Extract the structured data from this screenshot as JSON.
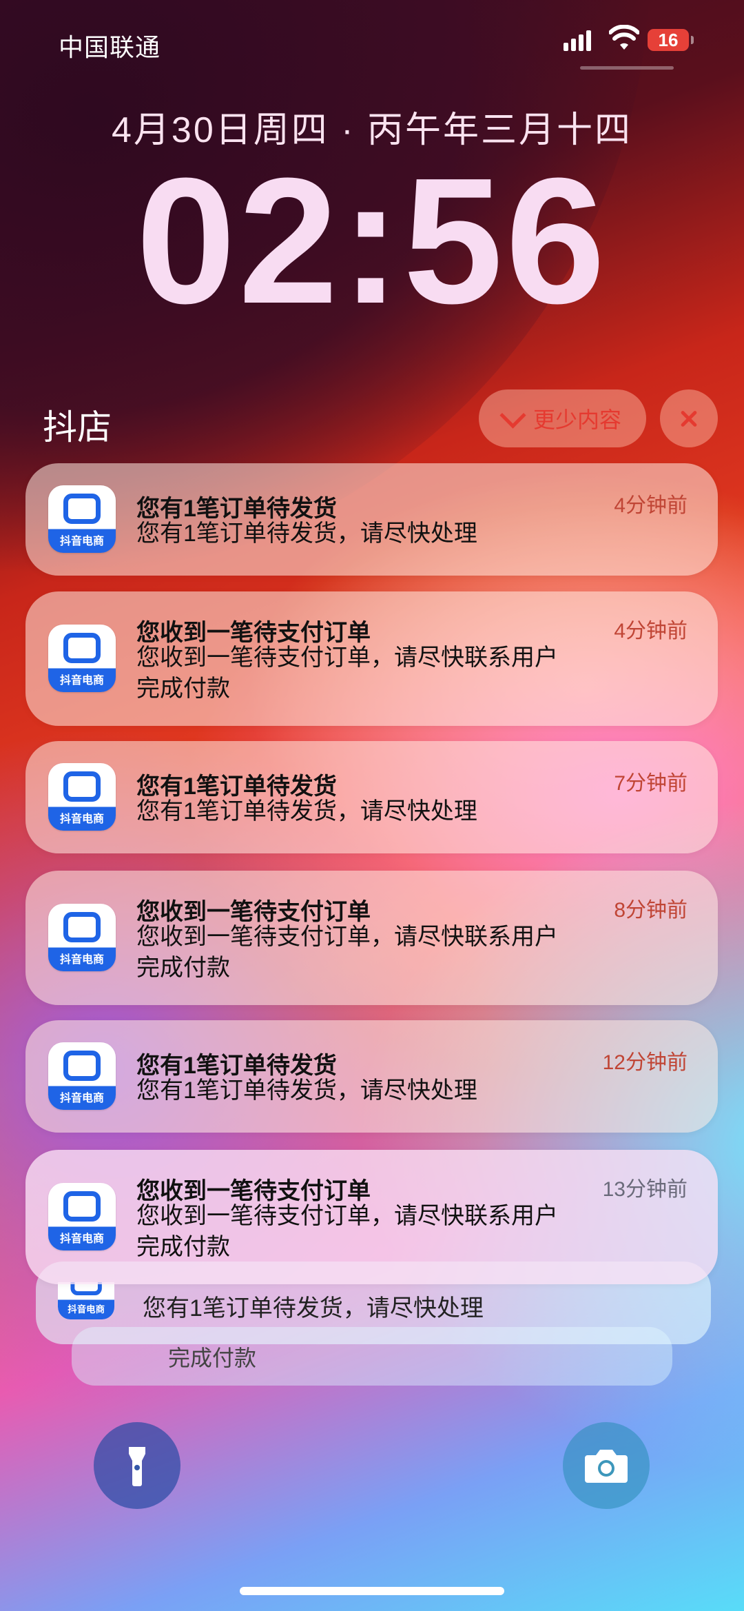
{
  "status_bar": {
    "carrier": "中国联通",
    "battery": "16"
  },
  "lock": {
    "date": "4月30日周四 · 丙午年三月十四",
    "time": "02:56"
  },
  "group": {
    "app_name": "抖店",
    "show_less_label": "更少内容"
  },
  "app_icon_caption": "抖音电商",
  "notifications": [
    {
      "title": "您有1笔订单待发货",
      "body": "您有1笔订单待发货，请尽快处理",
      "ago": "4分钟前"
    },
    {
      "title": "您收到一笔待支付订单",
      "body_line1": "您收到一笔待支付订单，请尽快联系用户",
      "body_line2": "完成付款",
      "ago": "4分钟前"
    },
    {
      "title": "您有1笔订单待发货",
      "body": "您有1笔订单待发货，请尽快处理",
      "ago": "7分钟前"
    },
    {
      "title": "您收到一笔待支付订单",
      "body_line1": "您收到一笔待支付订单，请尽快联系用户",
      "body_line2": "完成付款",
      "ago": "8分钟前"
    },
    {
      "title": "您有1笔订单待发货",
      "body": "您有1笔订单待发货，请尽快处理",
      "ago": "12分钟前"
    },
    {
      "title": "您收到一笔待支付订单",
      "body_line1": "您收到一笔待支付订单，请尽快联系用户",
      "body_line2": "完成付款",
      "ago": "13分钟前"
    }
  ],
  "stacked": [
    {
      "body": "您有1笔订单待发货，请尽快处理"
    },
    {
      "body": "完成付款"
    }
  ],
  "quick_actions": {
    "left_icon": "flashlight-icon",
    "right_icon": "camera-icon"
  },
  "colors": {
    "accent_red": "#e53a30",
    "battery_red": "#e64038",
    "app_blue": "#1f64e6"
  }
}
